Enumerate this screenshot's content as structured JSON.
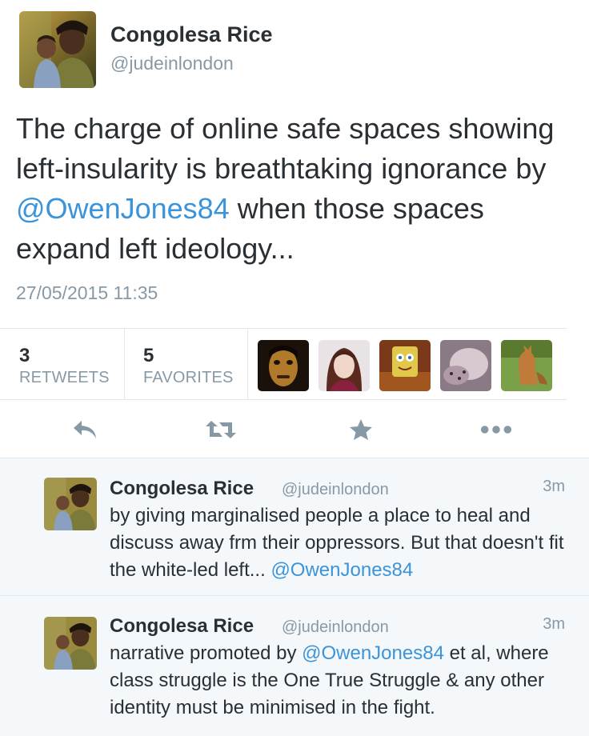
{
  "tweet": {
    "author_name": "Congolesa Rice",
    "author_handle": "@judeinlondon",
    "text_before": "The charge of online safe spaces showing left-insularity is breathtaking ignorance by ",
    "mention": "@OwenJones84",
    "text_after": " when those spaces expand left ideology...",
    "timestamp": "27/05/2015 11:35"
  },
  "stats": {
    "retweets_count": "3",
    "retweets_label": "RETWEETS",
    "favorites_count": "5",
    "favorites_label": "FAVORITES"
  },
  "actions": {
    "reply": "reply-icon",
    "retweet": "retweet-icon",
    "favorite": "star-icon",
    "more": "more-icon"
  },
  "replies": [
    {
      "author_name": "Congolesa Rice",
      "author_handle": "@judeinlondon",
      "time": "3m",
      "text": "by giving marginalised people a place to heal and discuss away frm their oppressors. But that doesn't fit the white-led left... ",
      "mention": "@OwenJones84",
      "text_after": ""
    },
    {
      "author_name": "Congolesa Rice",
      "author_handle": "@judeinlondon",
      "time": "3m",
      "text": "narrative promoted by ",
      "mention": "@OwenJones84",
      "text_after": " et al, where class struggle is the One True Struggle & any other identity must be minimised in the fight."
    }
  ],
  "colors": {
    "link": "#3b94d9",
    "muted": "#8899a6",
    "text": "#292f33",
    "reply_bg": "#f5f8fa",
    "border": "#e1e8ed"
  }
}
